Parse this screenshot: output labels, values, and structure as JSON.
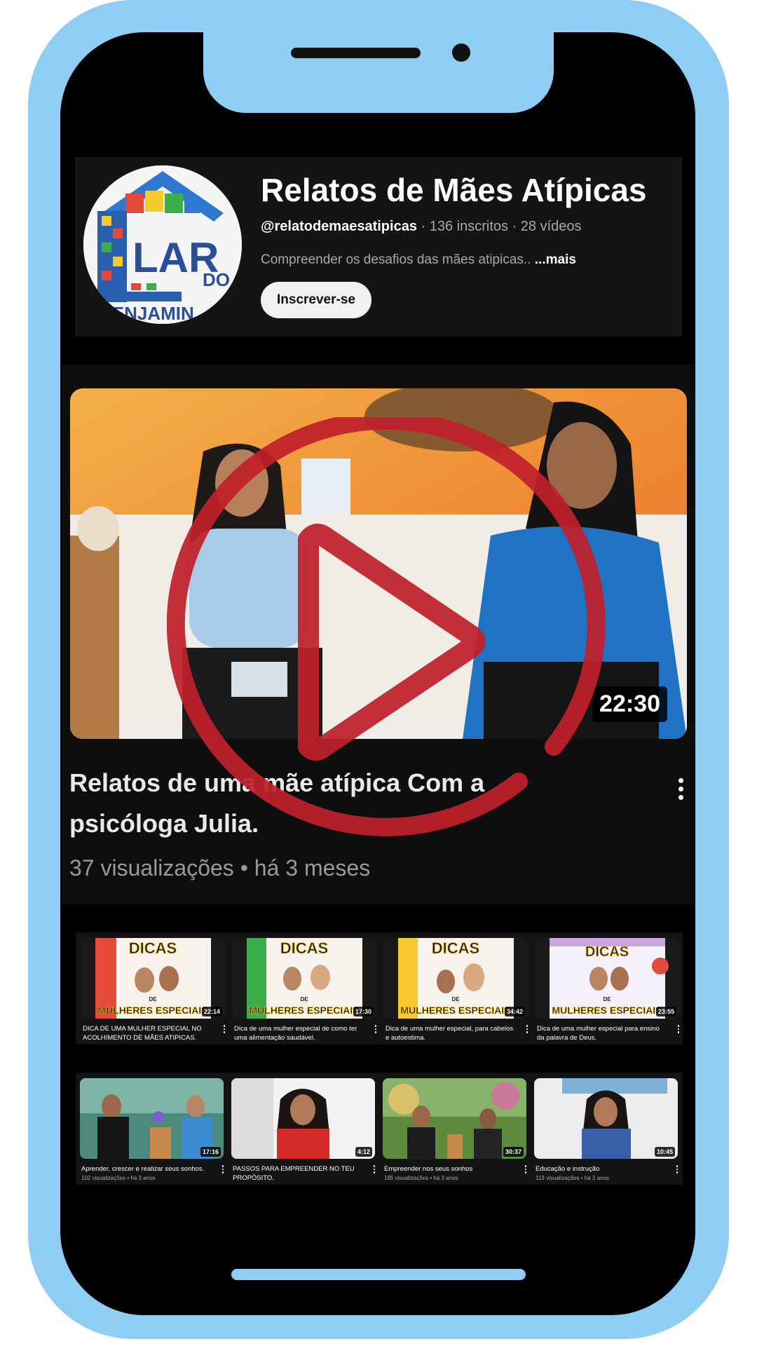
{
  "channel": {
    "name": "Relatos de Mães Atípicas",
    "handle": "@relatodemaesatipicas",
    "subscribers": "136 inscritos",
    "video_count": "28 vídeos",
    "description": "Compreender os desafios das mães atipicas..",
    "more_label": "...mais",
    "subscribe_label": "Inscrever-se",
    "avatar_text_1": "LAR",
    "avatar_text_2": "DO",
    "avatar_text_3": "BENJAMIN"
  },
  "featured": {
    "title": "Relatos de uma mãe atípica Com a psicóloga Julia.",
    "views": "37 visualizações",
    "age": "há 3 meses",
    "duration": "22:30"
  },
  "videos_row_1": [
    {
      "title": "DICA DE UMA MULHER ESPECIAL NO ACOLHIMENTO DE MÃES ATIPICAS.",
      "duration": "22:14",
      "thumb_top": "DICAS",
      "thumb_mid": "DE",
      "thumb_bottom": "MULHERES ESPECIAIS"
    },
    {
      "title": "Dica de uma mulher especial de como ter uma alimentação saudável.",
      "duration": "17:30",
      "thumb_top": "DICAS",
      "thumb_mid": "DE",
      "thumb_bottom": "MULHERES ESPECIAIS"
    },
    {
      "title": "Dica de uma mulher especial, para cabelos e autoestima.",
      "duration": "34:42",
      "thumb_top": "DICAS",
      "thumb_mid": "DE",
      "thumb_bottom": "MULHERES ESPECIAIS"
    },
    {
      "title": "Dica de uma mulher especial para ensino da palavra de Deus.",
      "duration": "23:55",
      "thumb_top": "DICAS",
      "thumb_mid": "DE",
      "thumb_bottom": "MULHERES ESPECIAIS"
    }
  ],
  "videos_row_2": [
    {
      "title": "Aprender, crescer e realizar seus sonhos.",
      "meta": "102 visualizações • há 3 anos",
      "duration": "17:16"
    },
    {
      "title": "PASSOS PARA EMPREENDER NO TEU PROPÓSITO.",
      "meta": "",
      "duration": "4:12"
    },
    {
      "title": "Empreender nos seus sonhos",
      "meta": "185 visualizações • há 3 anos",
      "duration": "30:37"
    },
    {
      "title": "Educação e instrução",
      "meta": "113 visualizações • há 3 anos",
      "duration": "10:45"
    }
  ],
  "colors": {
    "phone_frame": "#8fcef2",
    "play_overlay": "#c0202a",
    "screen_bg": "#000000"
  }
}
